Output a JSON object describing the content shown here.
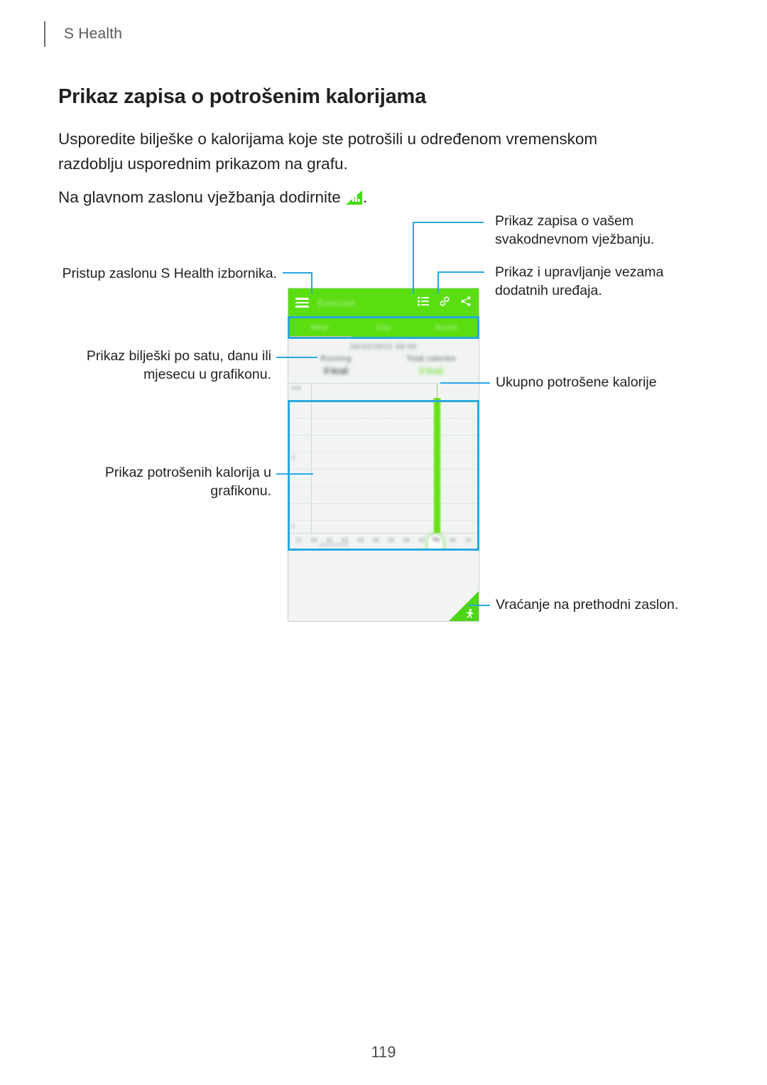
{
  "header": {
    "breadcrumb": "S Health"
  },
  "page": {
    "title": "Prikaz zapisa o potrošenim kalorijama",
    "intro_paragraph_1": "Usporedite bilješke o kalorijama koje ste potrošili u određenom vremenskom razdoblju usporednim prikazom na grafu.",
    "intro_paragraph_2_before_icon": "Na glavnom zaslonu vježbanja dodirnite ",
    "intro_paragraph_2_after_icon": ".",
    "inline_icon_name": "bar-chart-triangle-icon",
    "page_number": "119"
  },
  "callouts": {
    "menu_access": "Pristup zaslonu S Health izbornika.",
    "daily_records": "Prikaz zapisa o vašem\nsvakodnevnom vježbanju.",
    "daily_records_line1": "Prikaz zapisa o vašem",
    "daily_records_line2": "svakodnevnom vježbanju.",
    "accessories_line1": "Prikaz i upravljanje vezama",
    "accessories_line2": "dodatnih uređaja.",
    "period_line1": "Prikaz bilješki po satu, danu ili",
    "period_line2": "mjesecu u grafikonu.",
    "total_calories": "Ukupno potrošene kalorije",
    "chart_calories_line1": "Prikaz potrošenih kalorija u",
    "chart_calories_line2": "grafikonu.",
    "back": "Vraćanje na prethodni zaslon."
  },
  "phone": {
    "appbar": {
      "menu_icon": "hamburger-menu-icon",
      "title": "Exercise",
      "list_icon": "list-icon",
      "link_icon": "link-icon",
      "share_icon": "share-icon"
    },
    "tabs": [
      {
        "label": "Hour",
        "active": true
      },
      {
        "label": "Day",
        "active": false
      },
      {
        "label": "Month",
        "active": false
      }
    ],
    "summary": {
      "date": "26/02/2015 08:00",
      "metrics": [
        {
          "label": "Running",
          "value": "0 kcal"
        },
        {
          "label": "Total calories",
          "value": "0 kcal"
        }
      ]
    },
    "chart_axis": {
      "y_top": "kcal",
      "y_mid": "5",
      "y_bottom": "0",
      "x_ticks": [
        "22",
        "00",
        "01",
        "02",
        "03",
        "04",
        "05",
        "06",
        "07",
        "08",
        "09",
        "10"
      ],
      "x_selected": "08",
      "x_sublabel": "26/02/2015"
    },
    "back_icon": "running-person-icon"
  },
  "colors": {
    "brand_green": "#5ADE10",
    "callout_blue": "#29a8e0",
    "bar_green": "#6ce016",
    "panel_bg": "#f1f4f3"
  },
  "chart_data": {
    "type": "bar",
    "title": "Total calories",
    "xlabel": "",
    "ylabel": "kcal",
    "categories": [
      "22",
      "00",
      "01",
      "02",
      "03",
      "04",
      "05",
      "06",
      "07",
      "08",
      "09",
      "10"
    ],
    "values": [
      0,
      0,
      0,
      0,
      0,
      0,
      0,
      0,
      0,
      9.6,
      0,
      0
    ],
    "ylim": [
      0,
      10
    ],
    "grid": true,
    "legend": "none"
  }
}
